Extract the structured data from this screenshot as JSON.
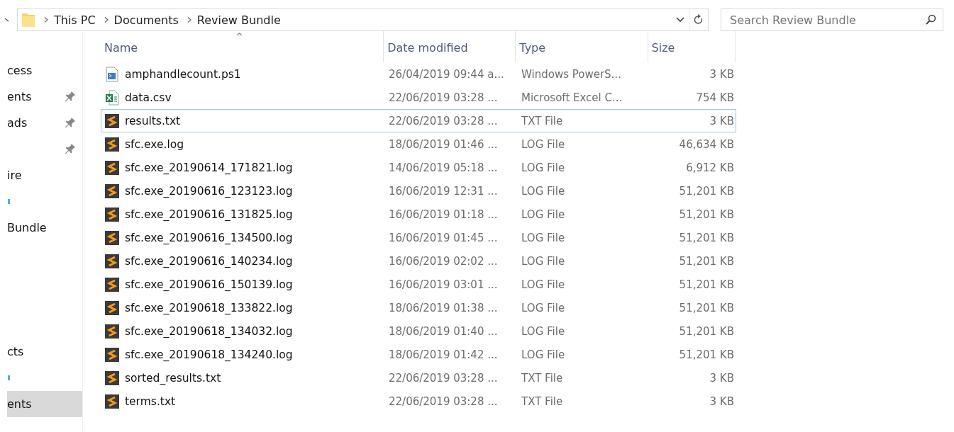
{
  "address_bar": {
    "path": [
      {
        "label": "This PC"
      },
      {
        "label": "Documents"
      },
      {
        "label": "Review Bundle"
      }
    ]
  },
  "search": {
    "placeholder": "Search Review Bundle"
  },
  "sidebar": {
    "items": [
      {
        "label": "cess",
        "pinned": false,
        "selected": false
      },
      {
        "label": "ents",
        "pinned": true,
        "selected": false
      },
      {
        "label": "ads",
        "pinned": true,
        "selected": false
      },
      {
        "pinned": true,
        "selected": false
      },
      {
        "label": "ire",
        "pinned": false,
        "selected": false
      },
      {
        "kind": "mark",
        "pinned": false,
        "selected": false
      },
      {
        "label": "Bundle",
        "pinned": false,
        "selected": false
      },
      {
        "kind": "gap"
      },
      {
        "kind": "gap"
      },
      {
        "kind": "gap"
      },
      {
        "kind": "gap"
      },
      {
        "label": "cts",
        "pinned": false,
        "selected": false
      },
      {
        "kind": "mark",
        "pinned": false,
        "selected": false
      },
      {
        "label": "ents",
        "pinned": false,
        "selected": true
      }
    ]
  },
  "table": {
    "sort_arrow": "^",
    "columns": [
      "Name",
      "Date modified",
      "Type",
      "Size"
    ],
    "rows": [
      {
        "kind": "powershell",
        "name": "amphandlecount.ps1",
        "date": "26/04/2019 09:44 a...",
        "type": "Windows PowerS...",
        "size": "3 KB",
        "selected": false
      },
      {
        "kind": "excel",
        "name": "data.csv",
        "date": "22/06/2019 03:28 ...",
        "type": "Microsoft Excel C...",
        "size": "754 KB",
        "selected": false
      },
      {
        "kind": "text",
        "name": "results.txt",
        "date": "22/06/2019 03:28 ...",
        "type": "TXT File",
        "size": "3 KB",
        "selected": true
      },
      {
        "kind": "text",
        "name": "sfc.exe.log",
        "date": "18/06/2019 01:46 ...",
        "type": "LOG File",
        "size": "46,634 KB",
        "selected": false
      },
      {
        "kind": "text",
        "name": "sfc.exe_20190614_171821.log",
        "date": "14/06/2019 05:18 ...",
        "type": "LOG File",
        "size": "6,912 KB",
        "selected": false
      },
      {
        "kind": "text",
        "name": "sfc.exe_20190616_123123.log",
        "date": "16/06/2019 12:31 ...",
        "type": "LOG File",
        "size": "51,201 KB",
        "selected": false
      },
      {
        "kind": "text",
        "name": "sfc.exe_20190616_131825.log",
        "date": "16/06/2019 01:18 ...",
        "type": "LOG File",
        "size": "51,201 KB",
        "selected": false
      },
      {
        "kind": "text",
        "name": "sfc.exe_20190616_134500.log",
        "date": "16/06/2019 01:45 ...",
        "type": "LOG File",
        "size": "51,201 KB",
        "selected": false
      },
      {
        "kind": "text",
        "name": "sfc.exe_20190616_140234.log",
        "date": "16/06/2019 02:02 ...",
        "type": "LOG File",
        "size": "51,201 KB",
        "selected": false
      },
      {
        "kind": "text",
        "name": "sfc.exe_20190616_150139.log",
        "date": "16/06/2019 03:01 ...",
        "type": "LOG File",
        "size": "51,201 KB",
        "selected": false
      },
      {
        "kind": "text",
        "name": "sfc.exe_20190618_133822.log",
        "date": "18/06/2019 01:38 ...",
        "type": "LOG File",
        "size": "51,201 KB",
        "selected": false
      },
      {
        "kind": "text",
        "name": "sfc.exe_20190618_134032.log",
        "date": "18/06/2019 01:40 ...",
        "type": "LOG File",
        "size": "51,201 KB",
        "selected": false
      },
      {
        "kind": "text",
        "name": "sfc.exe_20190618_134240.log",
        "date": "18/06/2019 01:42 ...",
        "type": "LOG File",
        "size": "51,201 KB",
        "selected": false
      },
      {
        "kind": "text",
        "name": "sorted_results.txt",
        "date": "22/06/2019 03:28 ...",
        "type": "TXT File",
        "size": "3 KB",
        "selected": false
      },
      {
        "kind": "text",
        "name": "terms.txt",
        "date": "22/06/2019 03:28 ...",
        "type": "TXT File",
        "size": "3 KB",
        "selected": false
      }
    ]
  }
}
